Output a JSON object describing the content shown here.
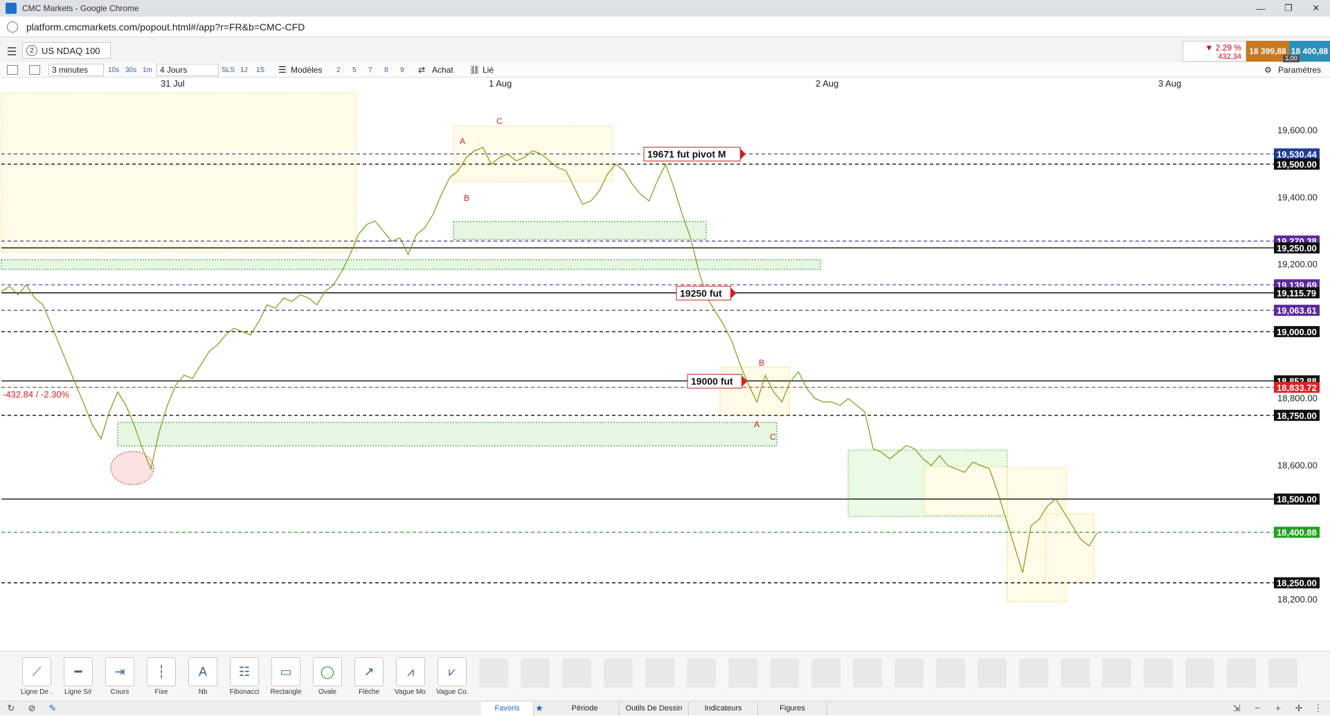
{
  "window": {
    "title": "CMC Markets - Google Chrome",
    "url": "platform.cmcmarkets.com/popout.html#/app?r=FR&b=CMC-CFD"
  },
  "instrument": {
    "number": "2",
    "name": "US NDAQ 100"
  },
  "quote": {
    "change_pct": "▼ 2.29 %",
    "change_abs": "432,34",
    "sell": "18 399,88",
    "buy": "18 400,88",
    "spread": "1,00"
  },
  "toolbar": {
    "interval": "3 minutes",
    "intervals": [
      "10s",
      "30s",
      "1m"
    ],
    "range": "4 Jours",
    "ranges": [
      "SLS",
      "1J",
      "1S"
    ],
    "templates_label": "Modèles",
    "template_nums": [
      "2",
      "5",
      "7",
      "8",
      "9"
    ],
    "buy_label": "Achat",
    "linked_label": "Lié",
    "settings_label": "Paramètres"
  },
  "date_labels": [
    "31 Jul",
    "1 Aug",
    "2 Aug",
    "3 Aug"
  ],
  "chart_data": {
    "type": "line",
    "y_ticks": [
      "19,600.00",
      "19,400.00",
      "19,200.00",
      "18,600.00",
      "18,200.00",
      "18,800.00"
    ],
    "y_range": [
      18150,
      19680
    ],
    "price_tags": [
      {
        "label": "19,530.44",
        "value": 19530.44,
        "color": "#1f3b99"
      },
      {
        "label": "19,500.00",
        "value": 19500,
        "color": "#111111"
      },
      {
        "label": "19,270.38",
        "value": 19270.38,
        "color": "#5a2a9c"
      },
      {
        "label": "19,250.00",
        "value": 19250,
        "color": "#111111"
      },
      {
        "label": "19,139.69",
        "value": 19139.69,
        "color": "#5a2a9c"
      },
      {
        "label": "19,115.79",
        "value": 19115.79,
        "color": "#111111"
      },
      {
        "label": "19,063.61",
        "value": 19063.61,
        "color": "#5a2a9c"
      },
      {
        "label": "19,000.00",
        "value": 19000,
        "color": "#111111"
      },
      {
        "label": "18,852.88",
        "value": 18852.88,
        "color": "#111111"
      },
      {
        "label": "18,833.72",
        "value": 18833.72,
        "color": "#e02020"
      },
      {
        "label": "18,750.00",
        "value": 18750,
        "color": "#111111"
      },
      {
        "label": "18,500.00",
        "value": 18500,
        "color": "#111111"
      },
      {
        "label": "18,400.88",
        "value": 18400.88,
        "color": "#22a020"
      },
      {
        "label": "18,250.00",
        "value": 18250,
        "color": "#111111"
      }
    ],
    "annotations": [
      {
        "text": "19671 fut pivot M",
        "value": 19530
      },
      {
        "text": "19250 fut",
        "value": 19115
      },
      {
        "text": "19000 fut",
        "value": 18852
      }
    ],
    "change_label": "-432.84 / -2.30%",
    "wave_labels": [
      "A",
      "B",
      "C",
      "A",
      "B",
      "C"
    ],
    "series": [
      {
        "values": [
          19120,
          19135,
          19110,
          19140,
          19100,
          19080,
          19020,
          18960,
          18900,
          18840,
          18780,
          18720,
          18680,
          18760,
          18820,
          18780,
          18720,
          18650,
          18590,
          18700,
          18780,
          18840,
          18870,
          18860,
          18900,
          18940,
          18960,
          18990,
          19010,
          19000,
          18990,
          19030,
          19080,
          19070,
          19100,
          19090,
          19110,
          19100,
          19080,
          19120,
          19140,
          19180,
          19230,
          19290,
          19320,
          19330,
          19300,
          19270,
          19280,
          19230,
          19290,
          19310,
          19350,
          19410,
          19460,
          19480,
          19520,
          19540,
          19550,
          19500,
          19520,
          19530,
          19510,
          19520,
          19540,
          19530,
          19510,
          19490,
          19480,
          19430,
          19380,
          19390,
          19420,
          19470,
          19500,
          19480,
          19440,
          19410,
          19390,
          19450,
          19500,
          19430,
          19350,
          19280,
          19180,
          19100,
          19060,
          19020,
          18970,
          18900,
          18840,
          18790,
          18870,
          18820,
          18790,
          18850,
          18880,
          18830,
          18800,
          18790,
          18790,
          18780,
          18800,
          18780,
          18760,
          18650,
          18640,
          18620,
          18640,
          18660,
          18650,
          18620,
          18600,
          18630,
          18600,
          18590,
          18580,
          18610,
          18600,
          18590,
          18520,
          18440,
          18360,
          18280,
          18420,
          18440,
          18480,
          18500,
          18460,
          18420,
          18380,
          18360,
          18400
        ]
      }
    ]
  },
  "drawing_tools": [
    {
      "label": "Ligne De ...",
      "icon": "trend-line-icon"
    },
    {
      "label": "Ligne S/r",
      "icon": "support-resistance-icon"
    },
    {
      "label": "Cours",
      "icon": "price-label-icon"
    },
    {
      "label": "Fixe",
      "icon": "fixed-line-icon"
    },
    {
      "label": "Nb",
      "icon": "text-note-icon"
    },
    {
      "label": "Fibonacci",
      "icon": "fibonacci-icon"
    },
    {
      "label": "Rectangle",
      "icon": "rectangle-icon"
    },
    {
      "label": "Ovale",
      "icon": "oval-icon"
    },
    {
      "label": "Flèche",
      "icon": "arrow-icon"
    },
    {
      "label": "Vague Mo...",
      "icon": "wave-mo-icon"
    },
    {
      "label": "Vague Co...",
      "icon": "wave-co-icon"
    }
  ],
  "status_tabs": [
    "Favoris",
    "Période",
    "Outils De Dessin",
    "Indicateurs",
    "Figures"
  ]
}
